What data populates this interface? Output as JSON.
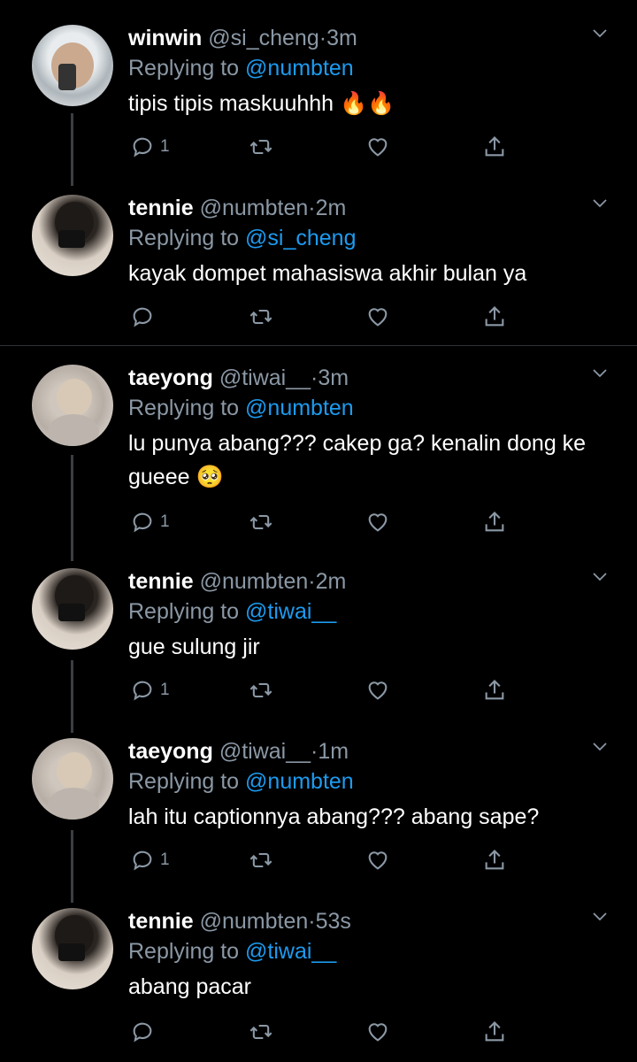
{
  "tweets": [
    {
      "name": "winwin",
      "handle": "@si_cheng",
      "time": "3m",
      "replying_label": "Replying to",
      "replying_to": "@numbten",
      "text": "tipis tipis maskuuhhh 🔥🔥",
      "reply_count": "1"
    },
    {
      "name": "tennie",
      "handle": "@numbten",
      "time": "2m",
      "replying_label": "Replying to",
      "replying_to": "@si_cheng",
      "text": "kayak dompet mahasiswa akhir bulan ya",
      "reply_count": ""
    },
    {
      "name": "taeyong",
      "handle": "@tiwai__",
      "time": "3m",
      "replying_label": "Replying to",
      "replying_to": "@numbten",
      "text": "lu punya abang??? cakep ga? kenalin dong ke gueee 🥺",
      "reply_count": "1"
    },
    {
      "name": "tennie",
      "handle": "@numbten",
      "time": "2m",
      "replying_label": "Replying to",
      "replying_to": "@tiwai__",
      "text": "gue sulung jir",
      "reply_count": "1"
    },
    {
      "name": "taeyong",
      "handle": "@tiwai__",
      "time": "1m",
      "replying_label": "Replying to",
      "replying_to": "@numbten",
      "text": "lah itu captionnya abang??? abang sape?",
      "reply_count": "1"
    },
    {
      "name": "tennie",
      "handle": "@numbten",
      "time": "53s",
      "replying_label": "Replying to",
      "replying_to": "@tiwai__",
      "text": "abang pacar",
      "reply_count": ""
    }
  ],
  "separator": "·",
  "icons": [
    "reply-icon",
    "retweet-icon",
    "like-icon",
    "share-icon",
    "chevron-down-icon"
  ],
  "colors": {
    "background": "#000000",
    "secondary_text": "#8b98a5",
    "mention": "#1d9bf0",
    "thread_line": "#3b3f43"
  }
}
